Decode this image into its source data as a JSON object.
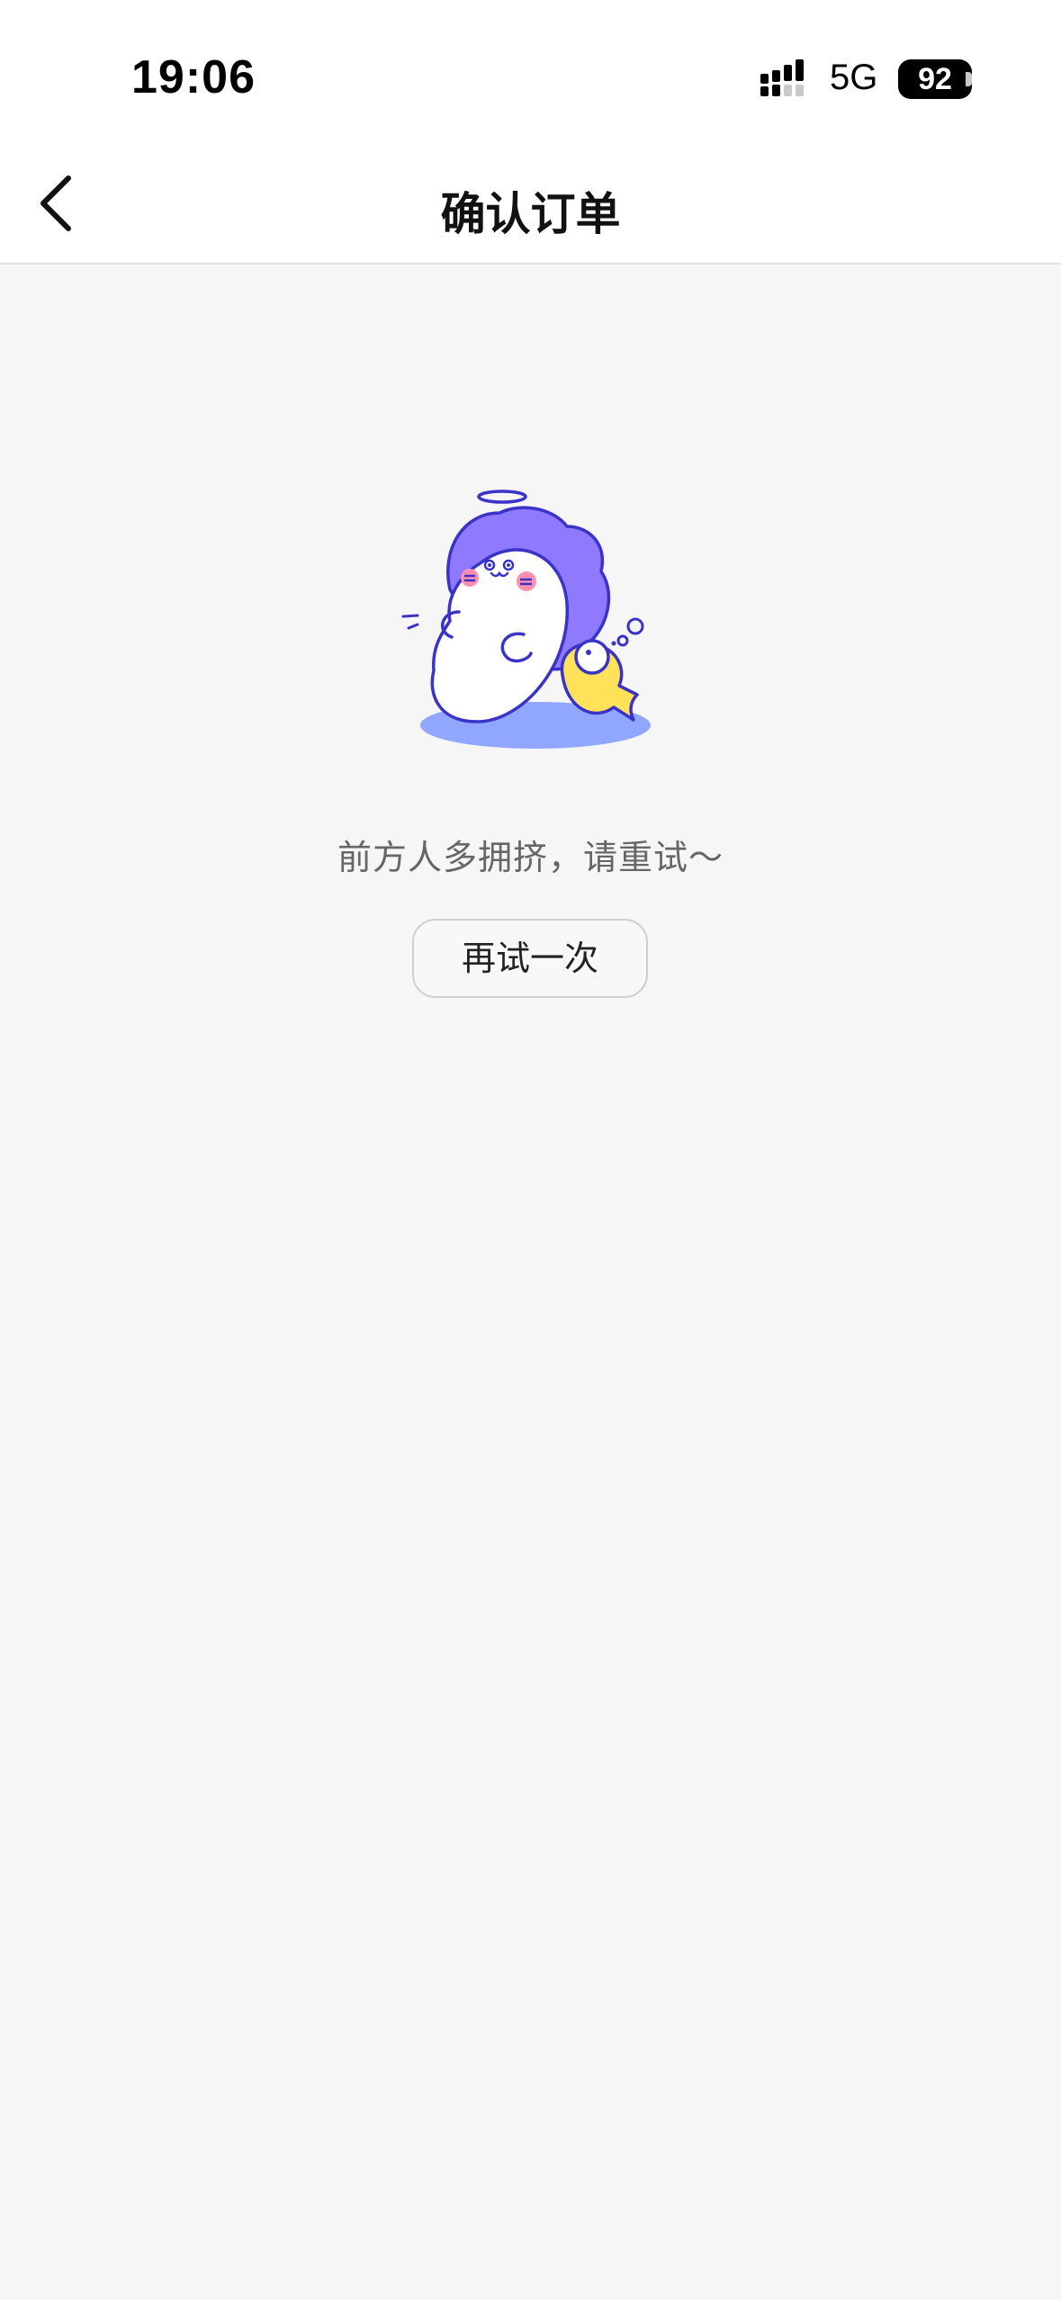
{
  "status_bar": {
    "time": "19:06",
    "network": "5G",
    "battery": "92"
  },
  "nav": {
    "back_icon": "chevron-left-icon",
    "title": "确认订单"
  },
  "empty_state": {
    "illustration": "cartoon-seal-with-fish",
    "message": "前方人多拥挤，请重试～",
    "retry_label": "再试一次"
  },
  "colors": {
    "background": "#f6f6f6",
    "bar": "#ffffff",
    "accent_purple": "#8e79ff",
    "outline_blue": "#3a33c8",
    "shadow_blue": "#91a7ff",
    "fish_yellow": "#ffe25a",
    "cheek_pink": "#ff8fb0"
  }
}
